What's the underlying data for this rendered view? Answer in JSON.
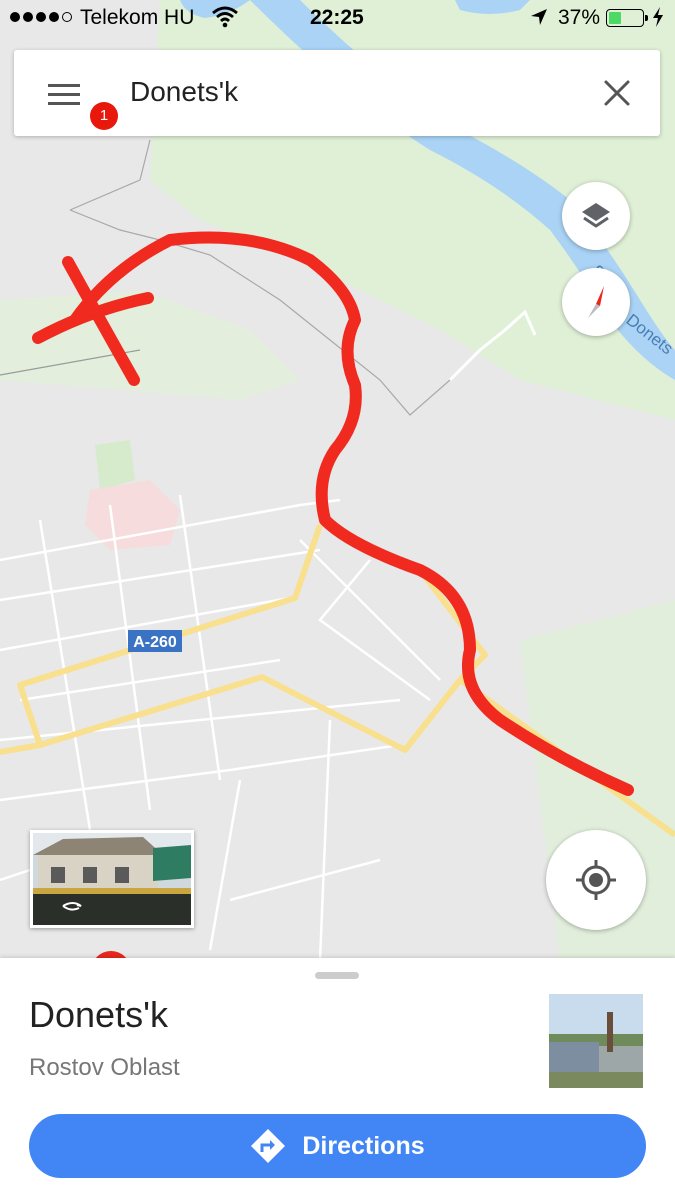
{
  "status_bar": {
    "carrier": "Telekom HU",
    "time": "22:25",
    "battery": "37%",
    "battery_level": 0.37
  },
  "search": {
    "query": "Donets'k",
    "notification_count": "1"
  },
  "map": {
    "road_label": "A-260",
    "river_label": "Severskiy Donets",
    "colors": {
      "land": "#e8e8e8",
      "park": "#dff0d6",
      "water": "#aad3f5",
      "road_major": "#f8e08e",
      "road_minor": "#ffffff",
      "drawn_route": "#f02a1e",
      "shield": "#3a73c4"
    }
  },
  "buttons": {
    "layers": "layers-icon",
    "compass": "compass-icon",
    "my_location": "my-location-icon"
  },
  "place": {
    "name": "Donets'k",
    "region": "Rostov Oblast"
  },
  "actions": {
    "directions": "Directions",
    "accent": "#4285f4"
  }
}
